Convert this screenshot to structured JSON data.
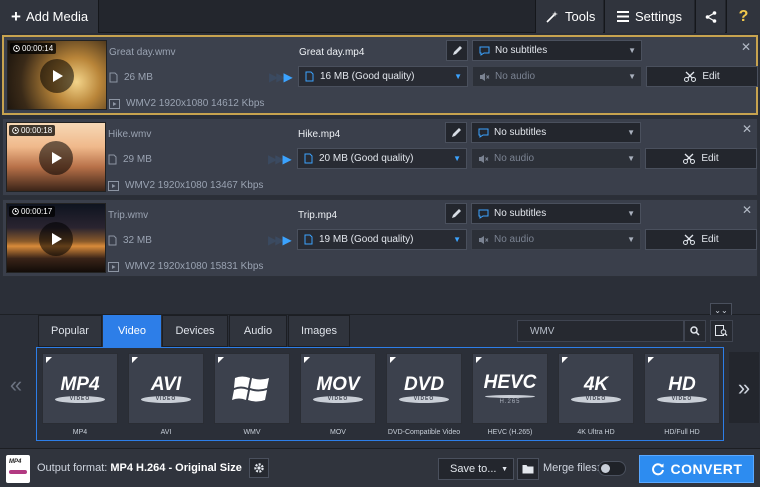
{
  "toolbar": {
    "add_media": "Add Media",
    "tools": "Tools",
    "settings": "Settings",
    "help": "?"
  },
  "files": [
    {
      "duration": "00:00:14",
      "source_name": "Great day.wmv",
      "source_size": "26 MB",
      "source_info": "WMV2 1920x1080 14612 Kbps",
      "output_name": "Great day.mp4",
      "output_size": "16 MB (Good quality)",
      "subtitles": "No subtitles",
      "audio": "No audio",
      "edit": "Edit",
      "selected": true
    },
    {
      "duration": "00:00:18",
      "source_name": "Hike.wmv",
      "source_size": "29 MB",
      "source_info": "WMV2 1920x1080 13467 Kbps",
      "output_name": "Hike.mp4",
      "output_size": "20 MB (Good quality)",
      "subtitles": "No subtitles",
      "audio": "No audio",
      "edit": "Edit",
      "selected": false
    },
    {
      "duration": "00:00:17",
      "source_name": "Trip.wmv",
      "source_size": "32 MB",
      "source_info": "WMV2 1920x1080 15831 Kbps",
      "output_name": "Trip.mp4",
      "output_size": "19 MB (Good quality)",
      "subtitles": "No subtitles",
      "audio": "No audio",
      "edit": "Edit",
      "selected": false
    }
  ],
  "tabs": [
    "Popular",
    "Video",
    "Devices",
    "Audio",
    "Images"
  ],
  "active_tab": "Video",
  "search": {
    "value": "WMV"
  },
  "formats": [
    {
      "big": "MP4",
      "disc": "VIDEO",
      "label": "MP4"
    },
    {
      "big": "AVI",
      "disc": "VIDEO",
      "label": "AVI"
    },
    {
      "big": "",
      "disc": "",
      "label": "WMV",
      "icon": "windows-logo-icon"
    },
    {
      "big": "MOV",
      "disc": "VIDEO",
      "label": "MOV"
    },
    {
      "big": "DVD",
      "disc": "VIDEO",
      "label": "DVD-Compatible Video"
    },
    {
      "big": "HEVC",
      "disc": "",
      "sub": "H.265",
      "label": "HEVC (H.265)"
    },
    {
      "big": "4K",
      "disc": "VIDEO",
      "label": "4K Ultra HD"
    },
    {
      "big": "HD",
      "disc": "VIDEO",
      "label": "HD/Full HD"
    }
  ],
  "bottom": {
    "output_format_label": "Output format:",
    "output_format_value": "MP4 H.264 - Original Size",
    "save_to": "Save to...",
    "merge_files": "Merge files:",
    "merge_enabled": false,
    "convert": "CONVERT",
    "file_icon_text": "MP4"
  },
  "colors": {
    "accent": "#2d7ee8",
    "convert": "#2d8cf0",
    "selected_border": "#c7a34f"
  }
}
